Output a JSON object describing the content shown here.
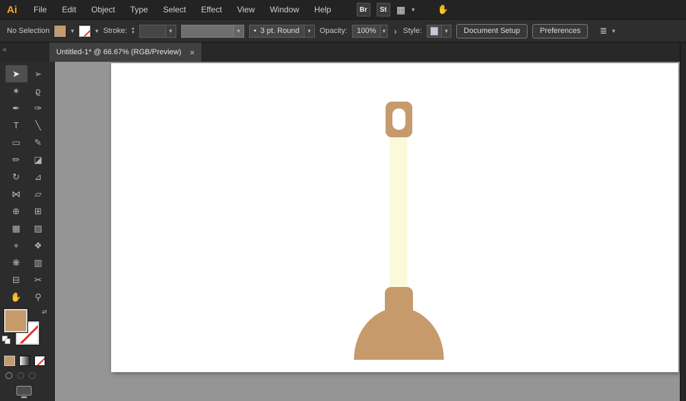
{
  "app": {
    "logo": "Ai"
  },
  "icons": {
    "chevron_down": "▾",
    "chevron_up": "▴",
    "flyout_arrow": "›",
    "close": "×",
    "swap_arrows": "⇄",
    "collapse_arrows": "«",
    "bullet": "•",
    "workspace_grid": "▦",
    "hand": "✋",
    "align": "≣"
  },
  "menu_bar": {
    "items": [
      {
        "name": "menu-file",
        "label": "File"
      },
      {
        "name": "menu-edit",
        "label": "Edit"
      },
      {
        "name": "menu-object",
        "label": "Object"
      },
      {
        "name": "menu-type",
        "label": "Type"
      },
      {
        "name": "menu-select",
        "label": "Select"
      },
      {
        "name": "menu-effect",
        "label": "Effect"
      },
      {
        "name": "menu-view",
        "label": "View"
      },
      {
        "name": "menu-window",
        "label": "Window"
      },
      {
        "name": "menu-help",
        "label": "Help"
      }
    ],
    "bridge_label": "Br",
    "stock_label": "St"
  },
  "control_bar": {
    "selection_status": "No Selection",
    "stroke_label": "Stroke:",
    "brush_value": "3 pt. Round",
    "opacity_label": "Opacity:",
    "opacity_value": "100%",
    "style_label": "Style:",
    "document_setup_label": "Document Setup",
    "preferences_label": "Preferences"
  },
  "tab_bar": {
    "active_tab": {
      "title": "Untitled-1* @ 66.67% (RGB/Preview)"
    }
  },
  "tools": [
    {
      "name": "selection-tool",
      "glyph": "➤",
      "cls": "selected"
    },
    {
      "name": "direct-selection-tool",
      "glyph": "➢"
    },
    {
      "name": "magic-wand-tool",
      "glyph": "✶"
    },
    {
      "name": "lasso-tool",
      "glyph": "ϱ"
    },
    {
      "name": "pen-tool",
      "glyph": "✒"
    },
    {
      "name": "curvature-tool",
      "glyph": "✑"
    },
    {
      "name": "type-tool",
      "glyph": "T"
    },
    {
      "name": "line-segment-tool",
      "glyph": "╲"
    },
    {
      "name": "rectangle-tool",
      "glyph": "▭"
    },
    {
      "name": "paintbrush-tool",
      "glyph": "✎"
    },
    {
      "name": "pencil-tool",
      "glyph": "✏"
    },
    {
      "name": "eraser-tool",
      "glyph": "◪"
    },
    {
      "name": "rotate-tool",
      "glyph": "↻"
    },
    {
      "name": "scale-tool",
      "glyph": "⊿"
    },
    {
      "name": "width-tool",
      "glyph": "⋈"
    },
    {
      "name": "free-transform-tool",
      "glyph": "▱"
    },
    {
      "name": "shape-builder-tool",
      "glyph": "⊕"
    },
    {
      "name": "perspective-grid-tool",
      "glyph": "⊞"
    },
    {
      "name": "mesh-tool",
      "glyph": "▦"
    },
    {
      "name": "gradient-tool",
      "glyph": "▨"
    },
    {
      "name": "eyedropper-tool",
      "glyph": "⌖"
    },
    {
      "name": "blend-tool",
      "glyph": "❖"
    },
    {
      "name": "symbol-sprayer-tool",
      "glyph": "❋"
    },
    {
      "name": "column-graph-tool",
      "glyph": "▥"
    },
    {
      "name": "artboard-tool",
      "glyph": "⊟"
    },
    {
      "name": "slice-tool",
      "glyph": "✂"
    },
    {
      "name": "hand-tool",
      "glyph": "✋"
    },
    {
      "name": "zoom-tool",
      "glyph": "⚲"
    }
  ],
  "colors": {
    "accent_orange": "#FF9C2A",
    "artwork_tan": "#C79A6C",
    "artwork_cream": "#FBF9DC",
    "none_slash_red": "#E0312E",
    "ui_dark": "#2E2E2E",
    "pasteboard_gray": "#959595"
  },
  "artwork": {
    "name": "plunger",
    "handle_color": "#C79A6C",
    "stick_color": "#FBF9DC",
    "cup_color": "#C79A6C"
  }
}
